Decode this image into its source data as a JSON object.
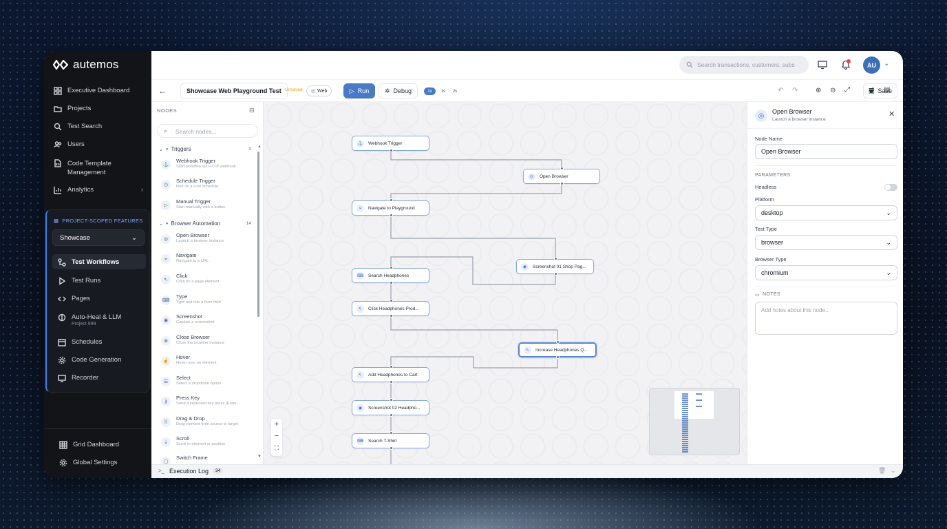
{
  "app": {
    "logo_text": "autemos"
  },
  "sidebar": {
    "items": [
      {
        "label": "Executive Dashboard",
        "icon": "dashboard-icon"
      },
      {
        "label": "Projects",
        "icon": "folder-icon"
      },
      {
        "label": "Test Search",
        "icon": "search-icon"
      },
      {
        "label": "Users",
        "icon": "users-icon"
      },
      {
        "label": "Code Template Management",
        "icon": "file-code-icon"
      },
      {
        "label": "Analytics",
        "icon": "chart-icon"
      }
    ],
    "scope_title": "PROJECT-SCOPED FEATURES",
    "project_select": "Showcase",
    "scoped_items": [
      {
        "label": "Test Workflows",
        "icon": "workflow-icon"
      },
      {
        "label": "Test Runs",
        "icon": "play-icon"
      },
      {
        "label": "Pages",
        "icon": "code-icon"
      },
      {
        "label": "Auto-Heal & LLM",
        "sub": "Project 999",
        "icon": "brain-icon"
      },
      {
        "label": "Schedules",
        "icon": "calendar-icon"
      },
      {
        "label": "Code Generation",
        "icon": "gear-icon"
      },
      {
        "label": "Recorder",
        "icon": "monitor-icon"
      }
    ],
    "bottom_items": [
      {
        "label": "Grid Dashboard",
        "icon": "grid-icon"
      },
      {
        "label": "Global Settings",
        "icon": "settings-icon"
      }
    ]
  },
  "topbar": {
    "search_placeholder": "Search transactions, customers, subs",
    "avatar": "AU"
  },
  "toolbar": {
    "workflow_name": "Showcase Web Playground Test",
    "unsaved": "Unsaved",
    "platform_badge": "Web",
    "run": "Run",
    "debug": "Debug",
    "speeds": [
      "1x",
      "1s",
      "2s"
    ],
    "save": "Save"
  },
  "nodes_panel": {
    "title": "NODES",
    "search_placeholder": "Search nodes...",
    "groups": [
      {
        "name": "Triggers",
        "count": "3"
      },
      {
        "name": "Browser Automation",
        "count": "14"
      }
    ],
    "items": [
      {
        "title": "Webhook Trigger",
        "desc": "Start workflow via HTTP webhook"
      },
      {
        "title": "Schedule Trigger",
        "desc": "Run on a cron schedule"
      },
      {
        "title": "Manual Trigger",
        "desc": "Start manually with a button"
      },
      {
        "title": "Open Browser",
        "desc": "Launch a browser instance"
      },
      {
        "title": "Navigate",
        "desc": "Navigate to a URL"
      },
      {
        "title": "Click",
        "desc": "Click on a page element"
      },
      {
        "title": "Type",
        "desc": "Type text into a form field"
      },
      {
        "title": "Screenshot",
        "desc": "Capture a screenshot"
      },
      {
        "title": "Close Browser",
        "desc": "Close the browser instance"
      },
      {
        "title": "Hover",
        "desc": "Hover over an element"
      },
      {
        "title": "Select",
        "desc": "Select a dropdown option"
      },
      {
        "title": "Press Key",
        "desc": "Send a keyboard key press (Enter,..."
      },
      {
        "title": "Drag & Drop",
        "desc": "Drag element from source to target"
      },
      {
        "title": "Scroll",
        "desc": "Scroll to element or position"
      },
      {
        "title": "Switch Frame",
        "desc": ""
      }
    ]
  },
  "flow_nodes": [
    {
      "label": "Webhook Trigger"
    },
    {
      "label": "Open Browser"
    },
    {
      "label": "Navigate to Playground"
    },
    {
      "label": "Screenshot 01 Shop Pag..."
    },
    {
      "label": "Search Headphones"
    },
    {
      "label": "Click Headphones Prod..."
    },
    {
      "label": "Increase Headphones Q..."
    },
    {
      "label": "Add Headphones to Cart"
    },
    {
      "label": "Screenshot 02 Headpho..."
    },
    {
      "label": "Search T-Shirt"
    }
  ],
  "properties": {
    "title": "Open Browser",
    "subtitle": "Launch a browser instance",
    "node_name_label": "Node Name",
    "node_name_value": "Open Browser",
    "parameters_label": "PARAMETERS",
    "headless_label": "Headless",
    "platform_label": "Platform",
    "platform_value": "desktop",
    "test_type_label": "Test Type",
    "test_type_value": "browser",
    "browser_type_label": "Browser Type",
    "browser_type_value": "chromium",
    "notes_label": "NOTES",
    "notes_placeholder": "Add notes about this node..."
  },
  "log": {
    "label": "Execution Log",
    "count": "34"
  }
}
